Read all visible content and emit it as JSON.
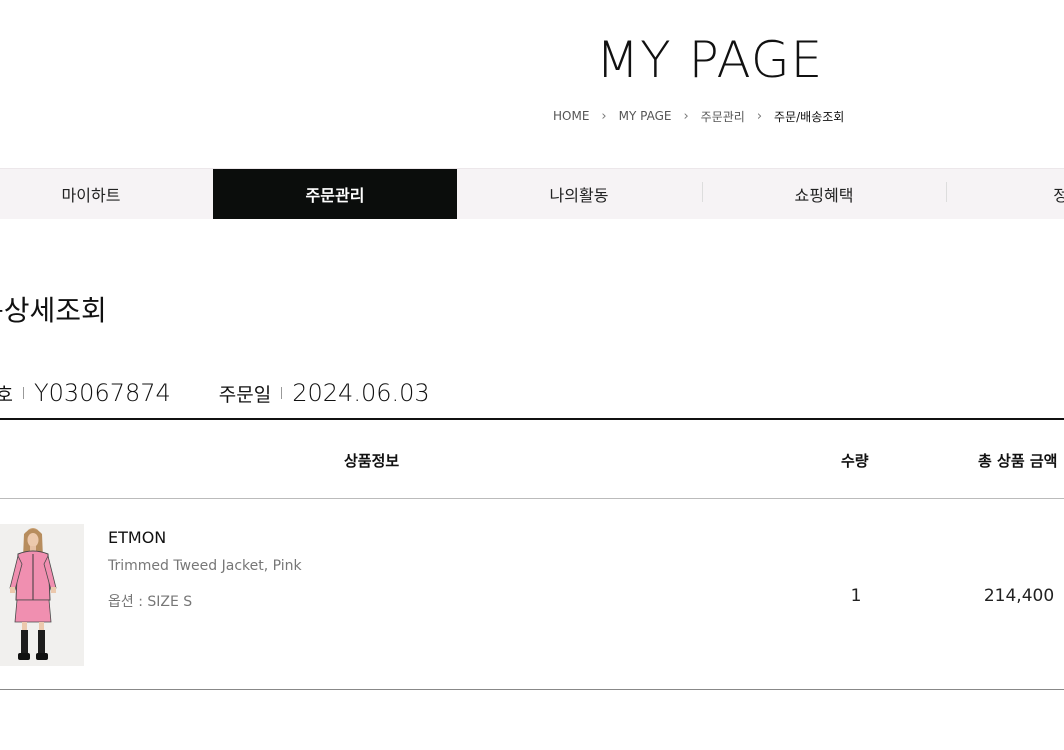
{
  "header": {
    "title": "MY PAGE",
    "breadcrumb": [
      {
        "label": "HOME"
      },
      {
        "label": "MY PAGE"
      },
      {
        "label": "주문관리"
      },
      {
        "label": "주문/배송조회"
      }
    ],
    "breadcrumb_separator": "›"
  },
  "tabs": [
    {
      "label": "마이하트",
      "active": false
    },
    {
      "label": "주문관리",
      "active": true
    },
    {
      "label": "나의활동",
      "active": false
    },
    {
      "label": "쇼핑혜택",
      "active": false
    },
    {
      "label": "정보",
      "active": false
    }
  ],
  "section": {
    "title": "문상세조회"
  },
  "order": {
    "number_label": "번호",
    "number": "Y03067874",
    "date_label": "주문일",
    "date": "2024.06.03"
  },
  "table": {
    "headers": {
      "product": "상품정보",
      "quantity": "수량",
      "total": "총 상품 금액"
    },
    "rows": [
      {
        "brand": "ETMON",
        "name": "Trimmed Tweed Jacket, Pink",
        "option": "옵션 : SIZE S",
        "quantity": "1",
        "total": "214,400"
      }
    ]
  },
  "colors": {
    "active_tab_bg": "#0b0d0c",
    "tabbar_bg": "#f6f3f5",
    "jacket": "#f08fb0"
  }
}
